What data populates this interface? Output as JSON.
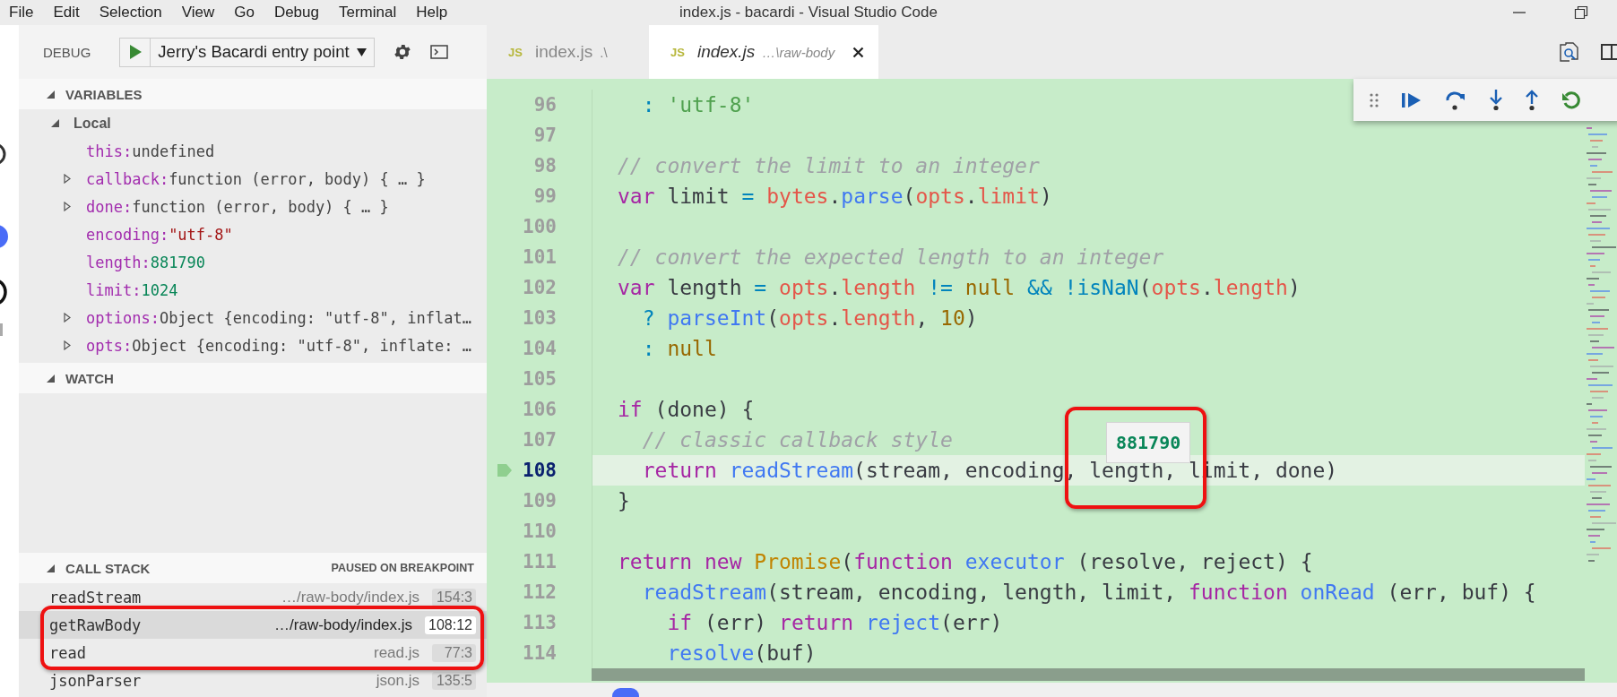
{
  "menu": [
    "File",
    "Edit",
    "Selection",
    "View",
    "Go",
    "Debug",
    "Terminal",
    "Help"
  ],
  "window": {
    "title": "index.js - bacardi - Visual Studio Code"
  },
  "debug_toolbar": {
    "label": "DEBUG",
    "configuration": "Jerry's Bacardi entry point"
  },
  "tabs": [
    {
      "icon_text": "JS",
      "label": "index.js",
      "path": ".\\",
      "selected": false
    },
    {
      "icon_text": "JS",
      "label": "index.js",
      "path": "…\\raw-body",
      "selected": true
    }
  ],
  "variables": {
    "title": "VARIABLES",
    "scope": {
      "label": "Local",
      "expanded": true
    },
    "items": [
      {
        "name": "this:",
        "value": "undefined",
        "kind": "plain",
        "expandable": false
      },
      {
        "name": "callback:",
        "value": "function (error, body) { … }",
        "kind": "plain",
        "expandable": true
      },
      {
        "name": "done:",
        "value": "function (error, body) { … }",
        "kind": "plain",
        "expandable": true
      },
      {
        "name": "encoding:",
        "value": "\"utf-8\"",
        "kind": "string",
        "expandable": false
      },
      {
        "name": "length:",
        "value": "881790",
        "kind": "number",
        "expandable": false
      },
      {
        "name": "limit:",
        "value": "1024",
        "kind": "number",
        "expandable": false
      },
      {
        "name": "options:",
        "value": "Object {encoding: \"utf-8\", inflat…",
        "kind": "plain",
        "expandable": true
      },
      {
        "name": "opts:",
        "value": "Object {encoding: \"utf-8\", inflate: …",
        "kind": "plain",
        "expandable": true
      }
    ]
  },
  "watch": {
    "title": "WATCH"
  },
  "call_stack": {
    "title": "CALL STACK",
    "status": "PAUSED ON BREAKPOINT",
    "frames": [
      {
        "name": "readStream",
        "file": "…/raw-body/index.js",
        "position": "154:3",
        "selected": false
      },
      {
        "name": "getRawBody",
        "file": "…/raw-body/index.js",
        "position": "108:12",
        "selected": true
      },
      {
        "name": "read",
        "file": "read.js",
        "position": "77:3",
        "selected": false
      },
      {
        "name": "jsonParser",
        "file": "json.js",
        "position": "135:5",
        "selected": false
      }
    ]
  },
  "editor": {
    "hover": {
      "value": "881790"
    },
    "lines": [
      {
        "number": "96",
        "current": false,
        "tokens": [
          {
            "t": "  : ",
            "kind": "op"
          },
          {
            "t": "'utf-8'",
            "kind": "str"
          }
        ]
      },
      {
        "number": "97",
        "current": false
      },
      {
        "number": "98",
        "current": false,
        "tokens": [
          {
            "t": "// convert the limit to an integer",
            "kind": "cmt"
          }
        ]
      },
      {
        "number": "99",
        "current": false,
        "tokens": [
          {
            "t": "var",
            "kind": "kw"
          },
          {
            "t": " limit ",
            "kind": "plain"
          },
          {
            "t": "=",
            "kind": "op"
          },
          {
            "t": " bytes",
            "kind": "prop"
          },
          {
            "t": ".",
            "kind": "plain"
          },
          {
            "t": "parse",
            "kind": "fn"
          },
          {
            "t": "(",
            "kind": "plain"
          },
          {
            "t": "opts",
            "kind": "prop"
          },
          {
            "t": ".",
            "kind": "plain"
          },
          {
            "t": "limit",
            "kind": "prop"
          },
          {
            "t": ")",
            "kind": "plain"
          }
        ]
      },
      {
        "number": "100",
        "current": false
      },
      {
        "number": "101",
        "current": false,
        "tokens": [
          {
            "t": "// convert the expected length to an integer",
            "kind": "cmt"
          }
        ]
      },
      {
        "number": "102",
        "current": false,
        "tokens": [
          {
            "t": "var",
            "kind": "kw"
          },
          {
            "t": " length ",
            "kind": "plain"
          },
          {
            "t": "=",
            "kind": "op"
          },
          {
            "t": " opts",
            "kind": "prop"
          },
          {
            "t": ".",
            "kind": "plain"
          },
          {
            "t": "length",
            "kind": "prop"
          },
          {
            "t": " !=",
            "kind": "op"
          },
          {
            "t": " null",
            "kind": "num"
          },
          {
            "t": " && !isNaN",
            "kind": "op"
          },
          {
            "t": "(",
            "kind": "plain"
          },
          {
            "t": "opts",
            "kind": "prop"
          },
          {
            "t": ".",
            "kind": "plain"
          },
          {
            "t": "length",
            "kind": "prop"
          },
          {
            "t": ")",
            "kind": "plain"
          }
        ]
      },
      {
        "number": "103",
        "current": false,
        "tokens": [
          {
            "t": "  ?",
            "kind": "op"
          },
          {
            "t": " parseInt",
            "kind": "fn"
          },
          {
            "t": "(",
            "kind": "plain"
          },
          {
            "t": "opts",
            "kind": "prop"
          },
          {
            "t": ".",
            "kind": "plain"
          },
          {
            "t": "length",
            "kind": "prop"
          },
          {
            "t": ", ",
            "kind": "plain"
          },
          {
            "t": "10",
            "kind": "num"
          },
          {
            "t": ")",
            "kind": "plain"
          }
        ]
      },
      {
        "number": "104",
        "current": false,
        "tokens": [
          {
            "t": "  :",
            "kind": "op"
          },
          {
            "t": " null",
            "kind": "num"
          }
        ]
      },
      {
        "number": "105",
        "current": false
      },
      {
        "number": "106",
        "current": false,
        "tokens": [
          {
            "t": "if",
            "kind": "kw"
          },
          {
            "t": " (done) {",
            "kind": "plain"
          }
        ]
      },
      {
        "number": "107",
        "current": false,
        "tokens": [
          {
            "t": "  // classic callback style",
            "kind": "cmt"
          }
        ]
      },
      {
        "number": "108",
        "current": true,
        "tokens": [
          {
            "t": "  return",
            "kind": "kw"
          },
          {
            "t": " readStream",
            "kind": "fn"
          },
          {
            "t": "(stream, encoding, length, limit, done)",
            "kind": "plain"
          }
        ]
      },
      {
        "number": "109",
        "current": false,
        "tokens": [
          {
            "t": "}",
            "kind": "plain"
          }
        ]
      },
      {
        "number": "110",
        "current": false
      },
      {
        "number": "111",
        "current": false,
        "tokens": [
          {
            "t": "return",
            "kind": "kw"
          },
          {
            "t": " new",
            "kind": "kw"
          },
          {
            "t": " Promise",
            "kind": "cls"
          },
          {
            "t": "(",
            "kind": "plain"
          },
          {
            "t": "function",
            "kind": "kw"
          },
          {
            "t": " executor",
            "kind": "fn"
          },
          {
            "t": " (resolve, reject) {",
            "kind": "plain"
          }
        ]
      },
      {
        "number": "112",
        "current": false,
        "tokens": [
          {
            "t": "  readStream",
            "kind": "fn"
          },
          {
            "t": "(stream, encoding, length, limit, ",
            "kind": "plain"
          },
          {
            "t": "function",
            "kind": "kw"
          },
          {
            "t": " onRead",
            "kind": "fn"
          },
          {
            "t": " (err, buf) {",
            "kind": "plain"
          }
        ]
      },
      {
        "number": "113",
        "current": false,
        "tokens": [
          {
            "t": "    if",
            "kind": "kw"
          },
          {
            "t": " (err) ",
            "kind": "plain"
          },
          {
            "t": "return",
            "kind": "kw"
          },
          {
            "t": " reject",
            "kind": "fn"
          },
          {
            "t": "(err)",
            "kind": "plain"
          }
        ]
      },
      {
        "number": "114",
        "current": false,
        "tokens": [
          {
            "t": "    resolve",
            "kind": "fn"
          },
          {
            "t": "(buf)",
            "kind": "plain"
          }
        ]
      }
    ]
  }
}
